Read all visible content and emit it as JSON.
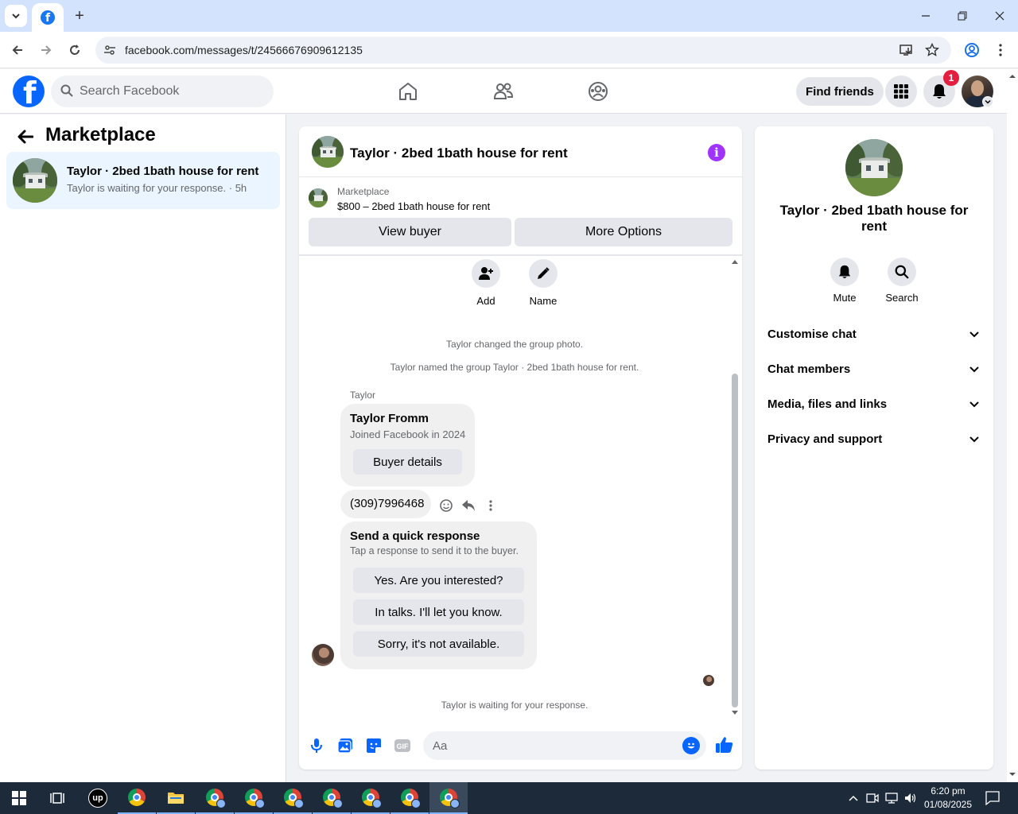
{
  "browser": {
    "url": "facebook.com/messages/t/24566676909612135",
    "new_tab_label": "+"
  },
  "fbnav": {
    "search_placeholder": "Search Facebook",
    "find_friends": "Find friends",
    "notification_count": "1"
  },
  "left_panel": {
    "title": "Marketplace",
    "thread": {
      "title": "Taylor · 2bed 1bath house for rent",
      "subtitle": "Taylor is waiting for your response. · 5h"
    }
  },
  "conversation": {
    "title": "Taylor · 2bed 1bath house for rent",
    "info_icon": "i",
    "marketplace_label": "Marketplace",
    "listing": "$800 – 2bed 1bath house for rent",
    "view_buyer": "View buyer",
    "more_options": "More Options",
    "actions": [
      {
        "label": "Add",
        "icon": "add-person-icon"
      },
      {
        "label": "Name",
        "icon": "pencil-icon"
      }
    ],
    "system_messages": [
      "Taylor changed the group photo.",
      "Taylor named the group Taylor · 2bed 1bath house for rent."
    ],
    "sender_name": "Taylor",
    "profile_card": {
      "name": "Taylor Fromm",
      "joined": "Joined Facebook in 2024",
      "button": "Buyer details"
    },
    "phone_message": "(309)7996468",
    "quick_response": {
      "title": "Send a quick response",
      "subtitle": "Tap a response to send it to the buyer.",
      "options": [
        "Yes. Are you interested?",
        "In talks. I'll let you know.",
        "Sorry, it's not available."
      ]
    },
    "waiting_status": "Taylor is waiting for your response.",
    "composer_placeholder": "Aa",
    "gif_label": "GIF"
  },
  "right_panel": {
    "title": "Taylor · 2bed 1bath house for rent",
    "actions": [
      {
        "label": "Mute",
        "icon": "bell-icon"
      },
      {
        "label": "Search",
        "icon": "search-icon"
      }
    ],
    "sections": [
      "Customise chat",
      "Chat members",
      "Media, files and links",
      "Privacy and support"
    ]
  },
  "taskbar": {
    "time": "6:20 pm",
    "date": "01/08/2025",
    "upwork_label": "up"
  },
  "colors": {
    "facebook_blue": "#0866ff",
    "info_purple": "#a033ff",
    "notification_red": "#e41e3f",
    "selected_thread_bg": "#ebf5ff"
  }
}
